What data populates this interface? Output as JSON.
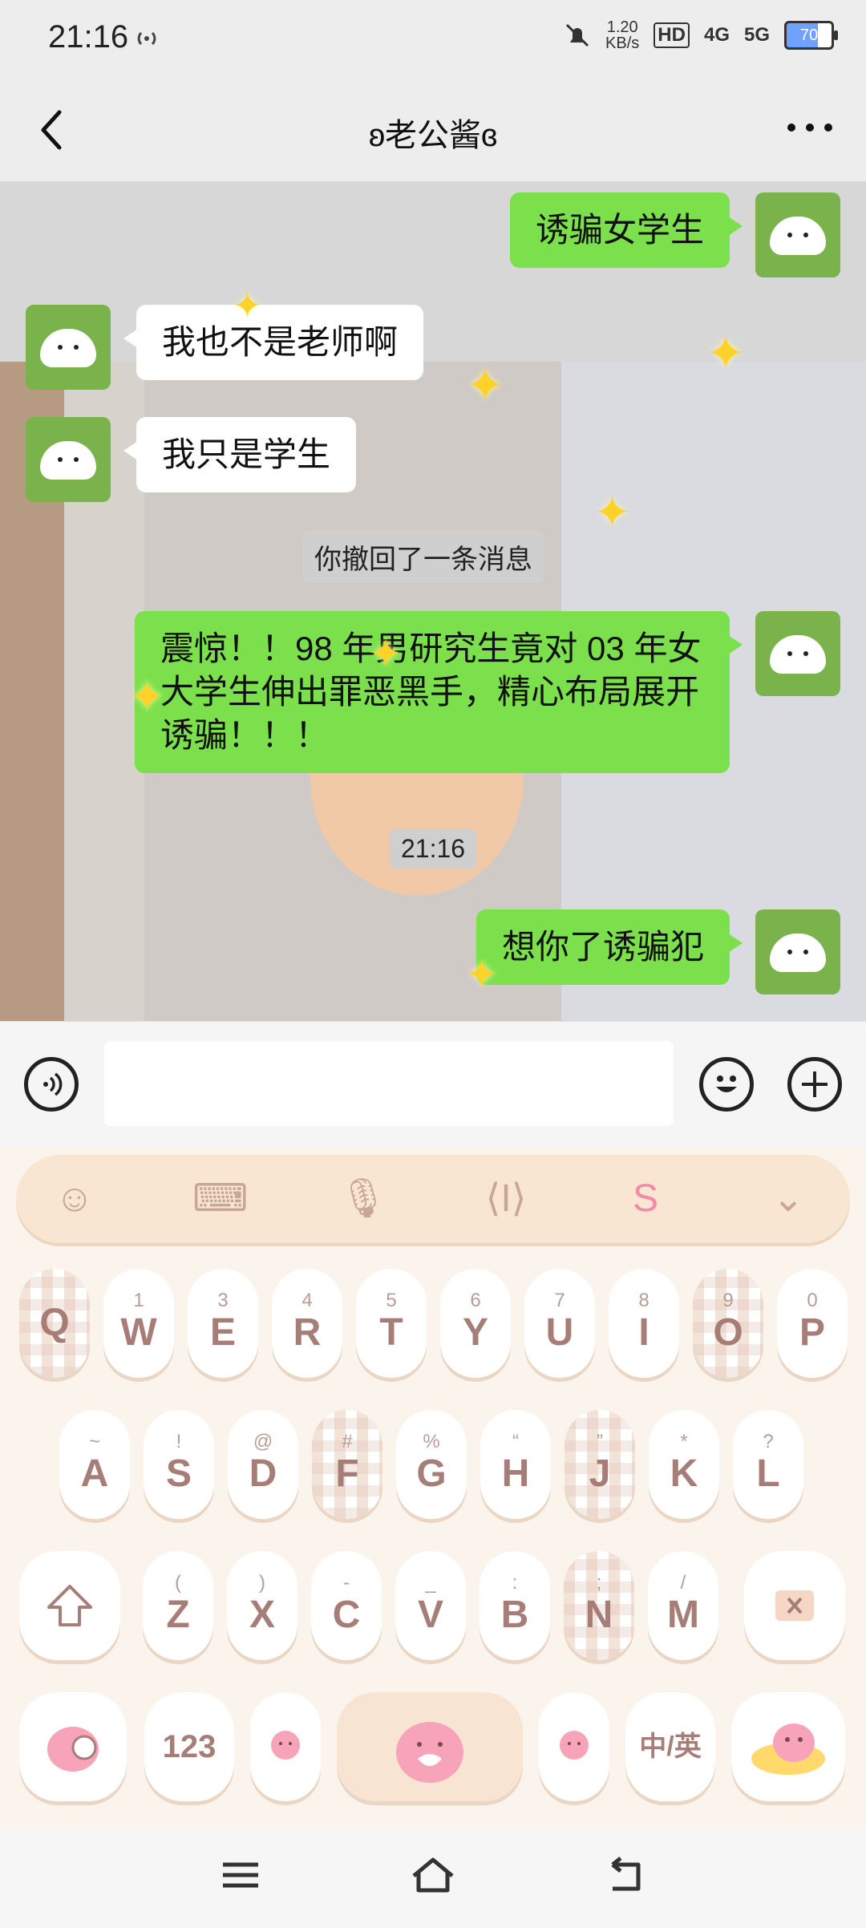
{
  "status_bar": {
    "time": "21:16",
    "net_speed_value": "1.20",
    "net_speed_unit": "KB/s",
    "hd_label": "HD",
    "signal_1": "4G",
    "signal_2": "5G",
    "battery": "70",
    "icons": [
      "hotspot-icon",
      "mute-icon",
      "hd-icon",
      "signal-icon",
      "battery-icon"
    ]
  },
  "header": {
    "title": "ʚ老公酱ɞ",
    "back_icon": "chevron-left-icon",
    "more_icon": "more-dots-icon"
  },
  "messages": [
    {
      "side": "right",
      "text": "诱骗女学生"
    },
    {
      "side": "left",
      "text": "我也不是老师啊"
    },
    {
      "side": "left",
      "text": "我只是学生"
    },
    {
      "type": "system",
      "text": "你撤回了一条消息"
    },
    {
      "side": "right",
      "text": "震惊！！98 年男研究生竟对 03 年女大学生伸出罪恶黑手，精心布局展开诱骗！！！"
    },
    {
      "type": "time",
      "text": "21:16"
    },
    {
      "side": "right",
      "text": "想你了诱骗犯"
    }
  ],
  "input_bar": {
    "voice_icon": "voice-icon",
    "emoji_icon": "smiley-icon",
    "plus_icon": "plus-icon",
    "placeholder": ""
  },
  "keyboard": {
    "toolbar_icons": [
      "smiley-icon",
      "keyboard-icon",
      "microphone-icon",
      "cursor-icon",
      "sogou-logo-icon",
      "chevron-down-icon"
    ],
    "row1": [
      {
        "main": "Q",
        "sub": ""
      },
      {
        "main": "W",
        "sub": "1"
      },
      {
        "main": "E",
        "sub": "3"
      },
      {
        "main": "R",
        "sub": "4"
      },
      {
        "main": "T",
        "sub": "5"
      },
      {
        "main": "Y",
        "sub": "6"
      },
      {
        "main": "U",
        "sub": "7"
      },
      {
        "main": "I",
        "sub": "8"
      },
      {
        "main": "O",
        "sub": "9"
      },
      {
        "main": "P",
        "sub": "0"
      }
    ],
    "row2": [
      {
        "main": "A",
        "sub": "~"
      },
      {
        "main": "S",
        "sub": "!"
      },
      {
        "main": "D",
        "sub": "@"
      },
      {
        "main": "F",
        "sub": "#"
      },
      {
        "main": "G",
        "sub": "%"
      },
      {
        "main": "H",
        "sub": "“"
      },
      {
        "main": "J",
        "sub": "”"
      },
      {
        "main": "K",
        "sub": "*"
      },
      {
        "main": "L",
        "sub": "?"
      }
    ],
    "row3": [
      {
        "main": "Z",
        "sub": "("
      },
      {
        "main": "X",
        "sub": ")"
      },
      {
        "main": "C",
        "sub": "-"
      },
      {
        "main": "V",
        "sub": "_"
      },
      {
        "main": "B",
        "sub": ":"
      },
      {
        "main": "N",
        "sub": ";"
      },
      {
        "main": "M",
        "sub": "/"
      }
    ],
    "shift_icon": "shift-arrow-icon",
    "delete_icon": "backspace-icon",
    "numbers_label": "123",
    "lang_label": "中/英",
    "space_icon": "space-mascot-icon",
    "emoji_key_icon": "emoji-mascot-icon",
    "punct_icon": "punctuation-mascot-icon",
    "enter_icon": "enter-mascot-icon"
  },
  "nav_bar": {
    "icons": [
      "menu-icon",
      "home-icon",
      "back-icon"
    ]
  },
  "colors": {
    "my_bubble": "#7be04b",
    "their_bubble": "#ffffff",
    "keyboard_bg": "#fbf4ec",
    "key_text": "#a77d77"
  }
}
